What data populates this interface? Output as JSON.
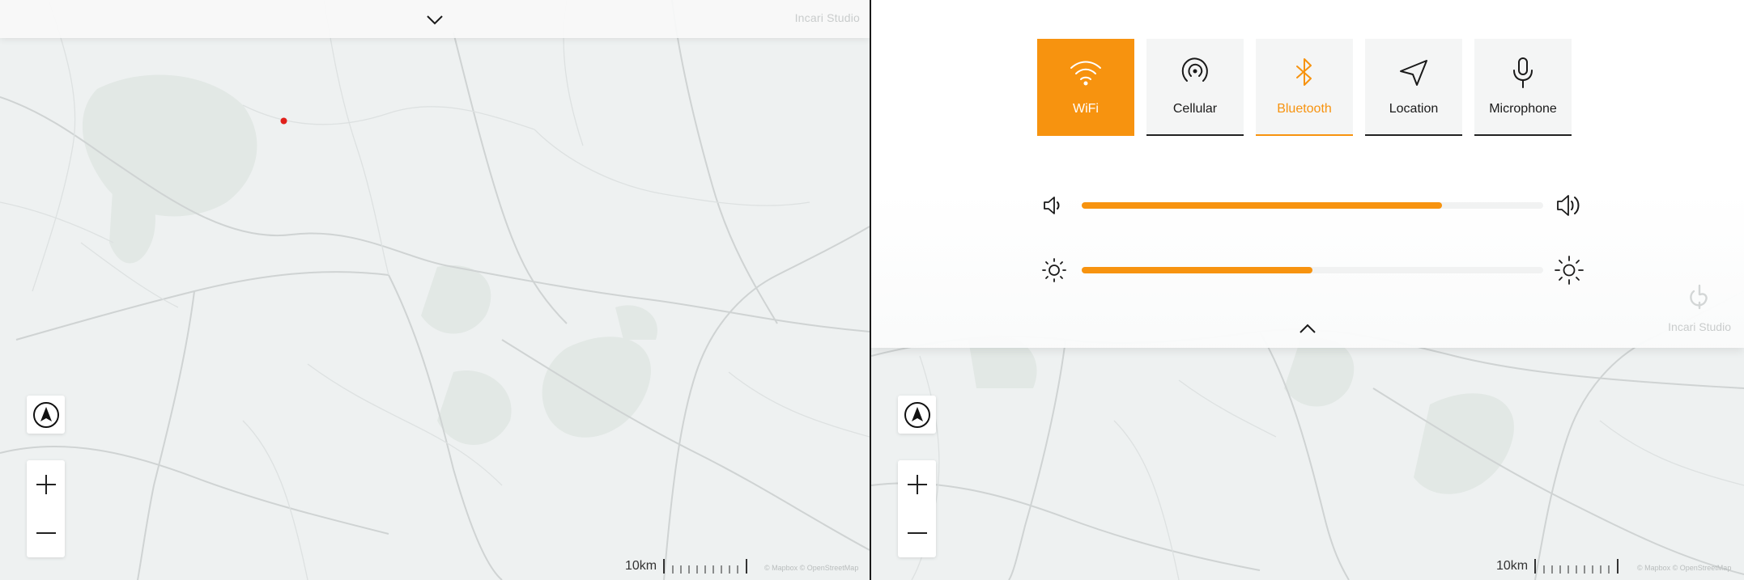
{
  "left": {
    "brand": "Incari Studio",
    "scale_label": "10km",
    "attribution": "© Mapbox © OpenStreetMap"
  },
  "right": {
    "brand": "Incari Studio",
    "scale_label": "10km",
    "attribution": "© Mapbox © OpenStreetMap",
    "tiles": [
      {
        "label": "WiFi",
        "icon": "wifi-icon",
        "state": "active"
      },
      {
        "label": "Cellular",
        "icon": "cellular-icon",
        "state": "off"
      },
      {
        "label": "Bluetooth",
        "icon": "bluetooth-icon",
        "state": "on"
      },
      {
        "label": "Location",
        "icon": "location-arrow-icon",
        "state": "off"
      },
      {
        "label": "Microphone",
        "icon": "microphone-icon",
        "state": "off"
      }
    ],
    "volume_level": 0.78,
    "brightness_level": 0.5
  },
  "colors": {
    "accent": "#f7930f",
    "map_background": "#eef1f1",
    "dark": "#1a1a1a",
    "marker": "#e0201b"
  }
}
